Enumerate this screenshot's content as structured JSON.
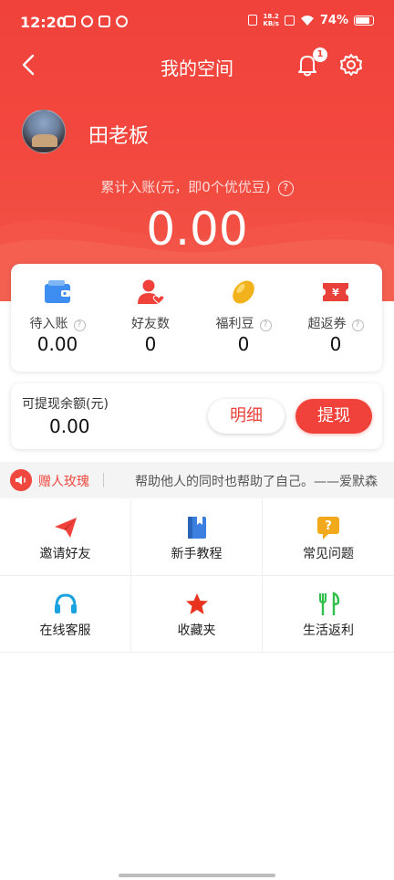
{
  "status_bar": {
    "time": "12:20",
    "net_speed_value": "18.2",
    "net_speed_unit": "KB/s",
    "battery": "74%"
  },
  "nav": {
    "title": "我的空间",
    "notification_count": "1"
  },
  "profile": {
    "username": "田老板"
  },
  "total": {
    "label": "累计入账(元，即0个优优豆)",
    "value": "0.00"
  },
  "stats": [
    {
      "label": "待入账",
      "value": "0.00",
      "icon": "wallet-icon",
      "color": "#3d8ef0"
    },
    {
      "label": "好友数",
      "value": "0",
      "icon": "friends-icon",
      "color": "#f0413a"
    },
    {
      "label": "福利豆",
      "value": "0",
      "icon": "bean-icon",
      "color": "#f2b21c"
    },
    {
      "label": "超返券",
      "value": "0",
      "icon": "coupon-icon",
      "color": "#e8413a"
    }
  ],
  "withdraw": {
    "label": "可提现余额(元)",
    "value": "0.00",
    "detail_button": "明细",
    "withdraw_button": "提现"
  },
  "quote": {
    "title": "赠人玫瑰",
    "text": "帮助他人的同时也帮助了自己。——爱默森"
  },
  "grid": [
    {
      "label": "邀请好友",
      "icon": "paper-plane-icon",
      "color": "#f0413a"
    },
    {
      "label": "新手教程",
      "icon": "book-icon",
      "color": "#3d7fe0"
    },
    {
      "label": "常见问题",
      "icon": "faq-icon",
      "color": "#f2a91c"
    },
    {
      "label": "在线客服",
      "icon": "headset-icon",
      "color": "#1aa3e0"
    },
    {
      "label": "收藏夹",
      "icon": "star-icon",
      "color": "#e8341f"
    },
    {
      "label": "生活返利",
      "icon": "utensils-icon",
      "color": "#2fbf4a"
    }
  ],
  "colors": {
    "brand_red": "#f0423b",
    "card_bg": "#ffffff"
  }
}
